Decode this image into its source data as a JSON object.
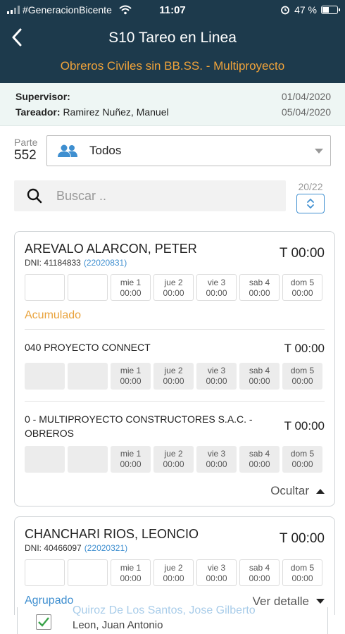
{
  "status": {
    "carrier": "#GeneracionBicente",
    "time": "11:07",
    "battery": "47 %"
  },
  "header": {
    "title": "S10 Tareo en Linea",
    "subtitle": "Obreros Civiles sin BB.SS. - Multiproyecto"
  },
  "info": {
    "supervisor_label": "Supervisor:",
    "supervisor_date": "01/04/2020",
    "tareador_label": "Tareador:",
    "tareador_name": "Ramirez Nuñez, Manuel",
    "tareador_date": "05/04/2020"
  },
  "filter": {
    "parte_label": "Parte",
    "parte_number": "552",
    "select_value": "Todos"
  },
  "search": {
    "placeholder": "Buscar ..",
    "counter": "20/22"
  },
  "day_labels": [
    {
      "day": "mie 1",
      "time": "00:00"
    },
    {
      "day": "jue 2",
      "time": "00:00"
    },
    {
      "day": "vie 3",
      "time": "00:00"
    },
    {
      "day": "sab 4",
      "time": "00:00"
    },
    {
      "day": "dom 5",
      "time": "00:00"
    }
  ],
  "workers": [
    {
      "name": "AREVALO ALARCON, PETER",
      "dni": "DNI: 41184833",
      "code": "(22020831)",
      "total": "T 00:00",
      "accum_label": "Acumulado",
      "projects": [
        {
          "name": "040 PROYECTO CONNECT",
          "total": "T 00:00"
        },
        {
          "name": "0 - MULTIPROYECTO CONSTRUCTORES S.A.C. - OBREROS",
          "total": "T 00:00"
        }
      ],
      "toggle_label": "Ocultar"
    },
    {
      "name": "CHANCHARI RIOS, LEONCIO",
      "dni": "DNI: 40466097",
      "code": "(22020321)",
      "total": "T 00:00",
      "group_label": "Agrupado",
      "detail_label": "Ver detalle"
    }
  ],
  "bottom": {
    "ghost_text": "Quiroz De Los Santos, Jose Gilberto",
    "name": "Leon, Juan Antonio"
  },
  "colors": {
    "header_bg": "#1d3a4c",
    "accent_orange": "#f0a33a",
    "accent_blue": "#3f8fd0",
    "check_green": "#3aa34a"
  }
}
